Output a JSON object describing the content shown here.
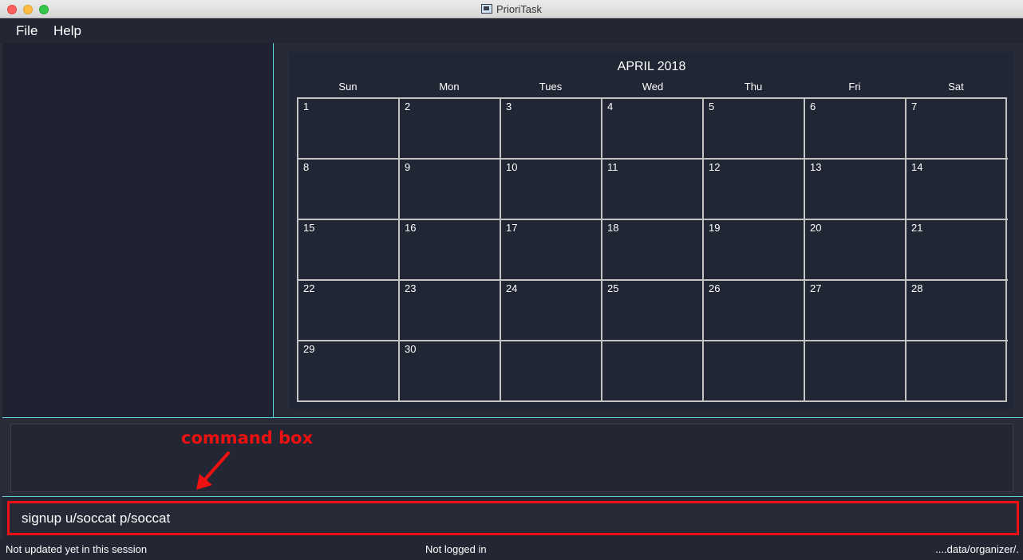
{
  "window": {
    "title": "PrioriTask"
  },
  "menu": {
    "items": [
      "File",
      "Help"
    ]
  },
  "calendar": {
    "title": "APRIL 2018",
    "weekdays": [
      "Sun",
      "Mon",
      "Tues",
      "Wed",
      "Thu",
      "Fri",
      "Sat"
    ],
    "days": [
      [
        "1",
        "2",
        "3",
        "4",
        "5",
        "6",
        "7"
      ],
      [
        "8",
        "9",
        "10",
        "11",
        "12",
        "13",
        "14"
      ],
      [
        "15",
        "16",
        "17",
        "18",
        "19",
        "20",
        "21"
      ],
      [
        "22",
        "23",
        "24",
        "25",
        "26",
        "27",
        "28"
      ],
      [
        "29",
        "30",
        "",
        "",
        "",
        "",
        ""
      ]
    ]
  },
  "annotation": {
    "label": "command box",
    "color": "#ee1111"
  },
  "command": {
    "value": "signup u/soccat p/soccat"
  },
  "status": {
    "sync": "Not updated yet in this session",
    "login": "Not logged in",
    "path": "....data/organizer/."
  },
  "colors": {
    "accent": "#5fd3dc",
    "annotation": "#ee1111",
    "background": "#2a2d38"
  }
}
